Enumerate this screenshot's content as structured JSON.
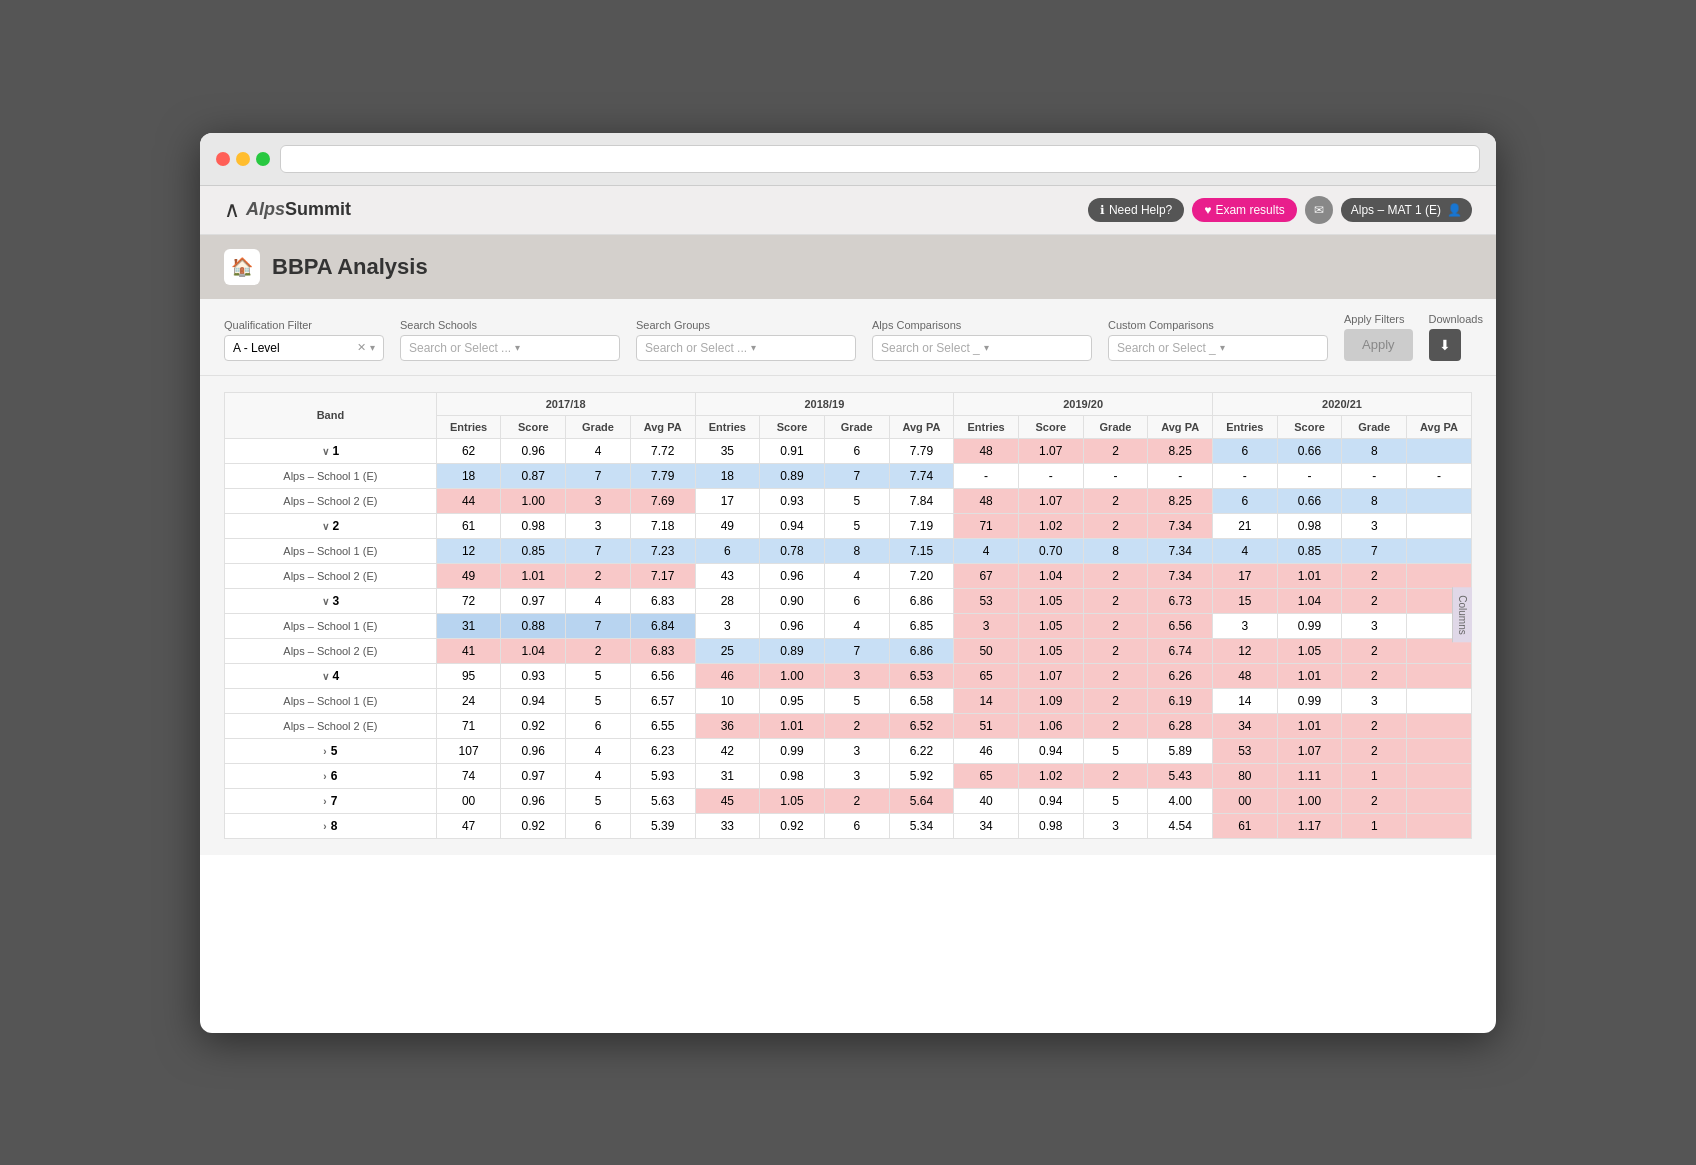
{
  "browser": {
    "address": ""
  },
  "header": {
    "logo_alps": "Alps",
    "logo_summit": "Summit",
    "btn_help": "Need Help?",
    "btn_exam": "Exam results",
    "btn_user": "Alps – MAT 1 (E)"
  },
  "page": {
    "title": "BBPA Analysis",
    "title_icon": "🏠"
  },
  "filters": {
    "qualification_label": "Qualification Filter",
    "qualification_value": "A - Level",
    "search_schools_label": "Search Schools",
    "search_schools_placeholder": "Search or Select ...",
    "search_groups_label": "Search Groups",
    "search_groups_placeholder": "Search or Select ...",
    "alps_comparisons_label": "Alps Comparisons",
    "alps_comparisons_placeholder": "Search or Select _",
    "custom_comparisons_label": "Custom Comparisons",
    "custom_comparisons_placeholder": "Search or Select _",
    "apply_label": "Apply Filters",
    "apply_btn": "Apply",
    "downloads_label": "Downloads"
  },
  "table": {
    "band_col": "Band",
    "years": [
      "2017/18",
      "2018/19",
      "2019/20",
      "2020/21"
    ],
    "sub_cols": [
      "Entries",
      "Score",
      "Grade",
      "Avg PA"
    ],
    "columns_btn": "Columns",
    "rows": [
      {
        "band": "1",
        "expanded": true,
        "y1": {
          "entries": 62,
          "score": "0.96",
          "grade": 4,
          "avg_pa": "7.72",
          "color": "normal"
        },
        "y2": {
          "entries": 35,
          "score": "0.91",
          "grade": 6,
          "avg_pa": "7.79",
          "color": "normal"
        },
        "y3": {
          "entries": 48,
          "score": "1.07",
          "grade": 2,
          "avg_pa": "8.25",
          "color": "pink-light"
        },
        "y4": {
          "entries": 6,
          "score": "0.66",
          "grade": 8,
          "avg_pa": "",
          "color": "blue-light"
        },
        "children": [
          {
            "name": "Alps – School 1 (E)",
            "y1": {
              "entries": 18,
              "score": "0.87",
              "grade": 7,
              "avg_pa": "7.79",
              "color": "blue-light"
            },
            "y2": {
              "entries": 18,
              "score": "0.89",
              "grade": 7,
              "avg_pa": "7.74",
              "color": "blue-light"
            },
            "y3": {
              "entries": "-",
              "score": "-",
              "grade": "-",
              "avg_pa": "-",
              "color": "normal"
            },
            "y4": {
              "entries": "-",
              "score": "-",
              "grade": "-",
              "avg_pa": "-",
              "color": "normal"
            }
          },
          {
            "name": "Alps – School 2 (E)",
            "y1": {
              "entries": 44,
              "score": "1.00",
              "grade": 3,
              "avg_pa": "7.69",
              "color": "pink-light"
            },
            "y2": {
              "entries": 17,
              "score": "0.93",
              "grade": 5,
              "avg_pa": "7.84",
              "color": "normal"
            },
            "y3": {
              "entries": 48,
              "score": "1.07",
              "grade": 2,
              "avg_pa": "8.25",
              "color": "pink-light"
            },
            "y4": {
              "entries": 6,
              "score": "0.66",
              "grade": 8,
              "avg_pa": "",
              "color": "blue-light"
            }
          }
        ]
      },
      {
        "band": "2",
        "expanded": true,
        "y1": {
          "entries": 61,
          "score": "0.98",
          "grade": 3,
          "avg_pa": "7.18",
          "color": "normal"
        },
        "y2": {
          "entries": 49,
          "score": "0.94",
          "grade": 5,
          "avg_pa": "7.19",
          "color": "normal"
        },
        "y3": {
          "entries": 71,
          "score": "1.02",
          "grade": 2,
          "avg_pa": "7.34",
          "color": "pink-light"
        },
        "y4": {
          "entries": 21,
          "score": "0.98",
          "grade": 3,
          "avg_pa": "",
          "color": "normal"
        },
        "children": [
          {
            "name": "Alps – School 1 (E)",
            "y1": {
              "entries": 12,
              "score": "0.85",
              "grade": 7,
              "avg_pa": "7.23",
              "color": "blue-light"
            },
            "y2": {
              "entries": 6,
              "score": "0.78",
              "grade": 8,
              "avg_pa": "7.15",
              "color": "blue-light"
            },
            "y3": {
              "entries": 4,
              "score": "0.70",
              "grade": 8,
              "avg_pa": "7.34",
              "color": "blue-light"
            },
            "y4": {
              "entries": 4,
              "score": "0.85",
              "grade": 7,
              "avg_pa": "",
              "color": "blue-light"
            }
          },
          {
            "name": "Alps – School 2 (E)",
            "y1": {
              "entries": 49,
              "score": "1.01",
              "grade": 2,
              "avg_pa": "7.17",
              "color": "pink-light"
            },
            "y2": {
              "entries": 43,
              "score": "0.96",
              "grade": 4,
              "avg_pa": "7.20",
              "color": "normal"
            },
            "y3": {
              "entries": 67,
              "score": "1.04",
              "grade": 2,
              "avg_pa": "7.34",
              "color": "pink-light"
            },
            "y4": {
              "entries": 17,
              "score": "1.01",
              "grade": 2,
              "avg_pa": "",
              "color": "pink-light"
            }
          }
        ]
      },
      {
        "band": "3",
        "expanded": true,
        "y1": {
          "entries": 72,
          "score": "0.97",
          "grade": 4,
          "avg_pa": "6.83",
          "color": "normal"
        },
        "y2": {
          "entries": 28,
          "score": "0.90",
          "grade": 6,
          "avg_pa": "6.86",
          "color": "normal"
        },
        "y3": {
          "entries": 53,
          "score": "1.05",
          "grade": 2,
          "avg_pa": "6.73",
          "color": "pink-light"
        },
        "y4": {
          "entries": 15,
          "score": "1.04",
          "grade": 2,
          "avg_pa": "",
          "color": "pink-light"
        },
        "children": [
          {
            "name": "Alps – School 1 (E)",
            "y1": {
              "entries": 31,
              "score": "0.88",
              "grade": 7,
              "avg_pa": "6.84",
              "color": "blue-medium"
            },
            "y2": {
              "entries": 3,
              "score": "0.96",
              "grade": 4,
              "avg_pa": "6.85",
              "color": "normal"
            },
            "y3": {
              "entries": 3,
              "score": "1.05",
              "grade": 2,
              "avg_pa": "6.56",
              "color": "pink-light"
            },
            "y4": {
              "entries": 3,
              "score": "0.99",
              "grade": 3,
              "avg_pa": "",
              "color": "normal"
            }
          },
          {
            "name": "Alps – School 2 (E)",
            "y1": {
              "entries": 41,
              "score": "1.04",
              "grade": 2,
              "avg_pa": "6.83",
              "color": "pink-light"
            },
            "y2": {
              "entries": 25,
              "score": "0.89",
              "grade": 7,
              "avg_pa": "6.86",
              "color": "blue-light"
            },
            "y3": {
              "entries": 50,
              "score": "1.05",
              "grade": 2,
              "avg_pa": "6.74",
              "color": "pink-light"
            },
            "y4": {
              "entries": 12,
              "score": "1.05",
              "grade": 2,
              "avg_pa": "",
              "color": "pink-light"
            }
          }
        ]
      },
      {
        "band": "4",
        "expanded": true,
        "y1": {
          "entries": 95,
          "score": "0.93",
          "grade": 5,
          "avg_pa": "6.56",
          "color": "normal"
        },
        "y2": {
          "entries": 46,
          "score": "1.00",
          "grade": 3,
          "avg_pa": "6.53",
          "color": "pink-light"
        },
        "y3": {
          "entries": 65,
          "score": "1.07",
          "grade": 2,
          "avg_pa": "6.26",
          "color": "pink-light"
        },
        "y4": {
          "entries": 48,
          "score": "1.01",
          "grade": 2,
          "avg_pa": "",
          "color": "pink-light"
        },
        "children": [
          {
            "name": "Alps – School 1 (E)",
            "y1": {
              "entries": 24,
              "score": "0.94",
              "grade": 5,
              "avg_pa": "6.57",
              "color": "normal"
            },
            "y2": {
              "entries": 10,
              "score": "0.95",
              "grade": 5,
              "avg_pa": "6.58",
              "color": "normal"
            },
            "y3": {
              "entries": 14,
              "score": "1.09",
              "grade": 2,
              "avg_pa": "6.19",
              "color": "pink-light"
            },
            "y4": {
              "entries": 14,
              "score": "0.99",
              "grade": 3,
              "avg_pa": "",
              "color": "normal"
            }
          },
          {
            "name": "Alps – School 2 (E)",
            "y1": {
              "entries": 71,
              "score": "0.92",
              "grade": 6,
              "avg_pa": "6.55",
              "color": "normal"
            },
            "y2": {
              "entries": 36,
              "score": "1.01",
              "grade": 2,
              "avg_pa": "6.52",
              "color": "pink-light"
            },
            "y3": {
              "entries": 51,
              "score": "1.06",
              "grade": 2,
              "avg_pa": "6.28",
              "color": "pink-light"
            },
            "y4": {
              "entries": 34,
              "score": "1.01",
              "grade": 2,
              "avg_pa": "",
              "color": "pink-light"
            }
          }
        ]
      },
      {
        "band": "5",
        "expanded": false,
        "y1": {
          "entries": 107,
          "score": "0.96",
          "grade": 4,
          "avg_pa": "6.23",
          "color": "normal"
        },
        "y2": {
          "entries": 42,
          "score": "0.99",
          "grade": 3,
          "avg_pa": "6.22",
          "color": "normal"
        },
        "y3": {
          "entries": 46,
          "score": "0.94",
          "grade": 5,
          "avg_pa": "5.89",
          "color": "normal"
        },
        "y4": {
          "entries": 53,
          "score": "1.07",
          "grade": 2,
          "avg_pa": "",
          "color": "pink-light"
        },
        "children": []
      },
      {
        "band": "6",
        "expanded": false,
        "y1": {
          "entries": 74,
          "score": "0.97",
          "grade": 4,
          "avg_pa": "5.93",
          "color": "normal"
        },
        "y2": {
          "entries": 31,
          "score": "0.98",
          "grade": 3,
          "avg_pa": "5.92",
          "color": "normal"
        },
        "y3": {
          "entries": 65,
          "score": "1.02",
          "grade": 2,
          "avg_pa": "5.43",
          "color": "pink-light"
        },
        "y4": {
          "entries": 80,
          "score": "1.11",
          "grade": 1,
          "avg_pa": "",
          "color": "pink-light"
        },
        "children": []
      },
      {
        "band": "7",
        "expanded": false,
        "y1": {
          "entries": "00",
          "score": "0.96",
          "grade": 5,
          "avg_pa": "5.63",
          "color": "normal"
        },
        "y2": {
          "entries": 45,
          "score": "1.05",
          "grade": 2,
          "avg_pa": "5.64",
          "color": "pink-light"
        },
        "y3": {
          "entries": 40,
          "score": "0.94",
          "grade": 5,
          "avg_pa": "4.00",
          "color": "normal"
        },
        "y4": {
          "entries": "00",
          "score": "1.00",
          "grade": 2,
          "avg_pa": "",
          "color": "pink-light"
        },
        "children": []
      },
      {
        "band": "8",
        "expanded": false,
        "y1": {
          "entries": 47,
          "score": "0.92",
          "grade": 6,
          "avg_pa": "5.39",
          "color": "normal"
        },
        "y2": {
          "entries": 33,
          "score": "0.92",
          "grade": 6,
          "avg_pa": "5.34",
          "color": "normal"
        },
        "y3": {
          "entries": 34,
          "score": "0.98",
          "grade": 3,
          "avg_pa": "4.54",
          "color": "normal"
        },
        "y4": {
          "entries": 61,
          "score": "1.17",
          "grade": 1,
          "avg_pa": "",
          "color": "pink-light"
        },
        "children": []
      }
    ]
  }
}
